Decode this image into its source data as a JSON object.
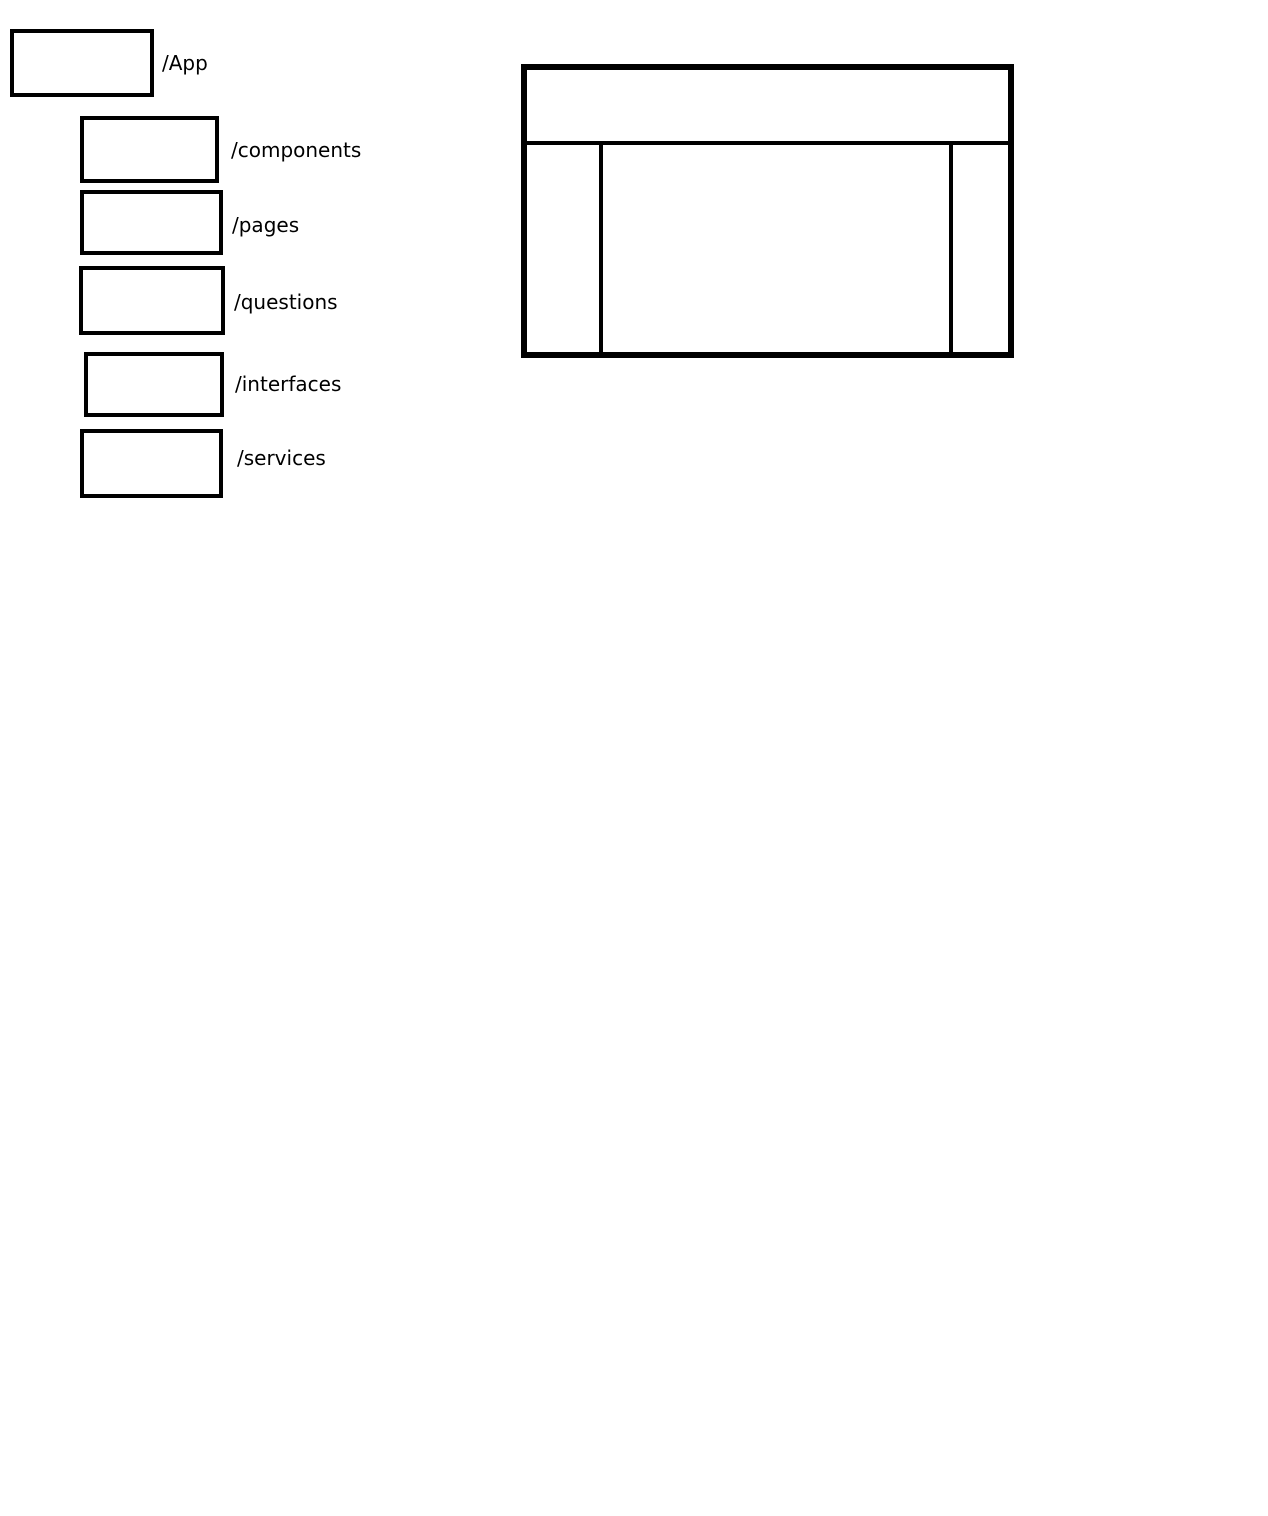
{
  "folder_tree": {
    "root": {
      "label": "/App"
    },
    "children": [
      {
        "label": "/components"
      },
      {
        "label": "/pages"
      },
      {
        "label": "/questions"
      },
      {
        "label": "/interfaces"
      },
      {
        "label": "/services"
      }
    ]
  },
  "layout_wireframe": {
    "regions": [
      "header",
      "left-column",
      "main-content",
      "right-column"
    ]
  },
  "colors": {
    "stroke": "#000000",
    "background": "#ffffff"
  }
}
